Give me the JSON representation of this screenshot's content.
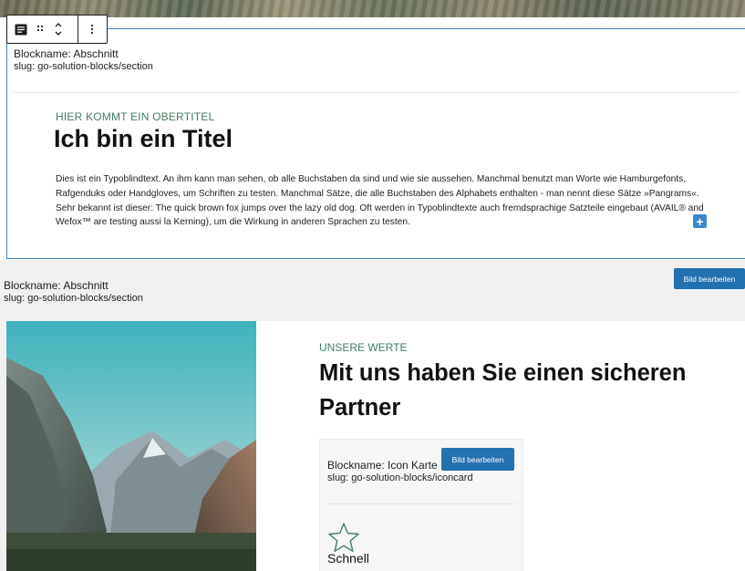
{
  "toolbar": {
    "block_icon": "paragraph-block-icon",
    "drag_icon": "drag-handle-icon",
    "move_icon": "move-up-down-icon",
    "more_icon": "more-options-icon"
  },
  "section1": {
    "blockname": "Blockname: Abschnitt",
    "slug": "slug: go-solution-blocks/section",
    "overline": "HIER KOMMT EIN OBERTITEL",
    "title": "Ich bin ein Titel",
    "body": "Dies ist ein Typoblindtext. An ihm kann man sehen, ob alle Buchstaben da sind und wie sie aussehen. Manchmal benutzt man Worte wie Hamburgefonts, Rafgenduks oder Handgloves, um Schriften zu testen. Manchmal Sätze, die alle Buchstaben des Alphabets enthalten - man nennt diese Sätze »Pangrams«. Sehr bekannt ist dieser: The quick brown fox jumps over the lazy old dog. Oft werden in Typoblindtexte auch fremdsprachige Satzteile eingebaut (AVAIL® and Wefox™ are testing aussi la Kerning), um die Wirkung in anderen Sprachen zu testen.",
    "add_label": "+"
  },
  "section2": {
    "blockname": "Blockname: Abschnitt",
    "slug": "slug: go-solution-blocks/section",
    "edit_image_label": "Bild bearbeiten",
    "overline": "UNSERE WERTE",
    "title": "Mit uns haben Sie einen sicheren Partner"
  },
  "iconcard": {
    "blockname": "Blockname: Icon Karte",
    "slug": "slug: go-solution-blocks/iconcard",
    "edit_image_label": "Bild bearbeiten",
    "icon": "star-icon",
    "label": "Schnell"
  },
  "colors": {
    "accent_green": "#3f7d62",
    "selection_blue": "#3a86c8",
    "button_blue": "#2271b1"
  }
}
